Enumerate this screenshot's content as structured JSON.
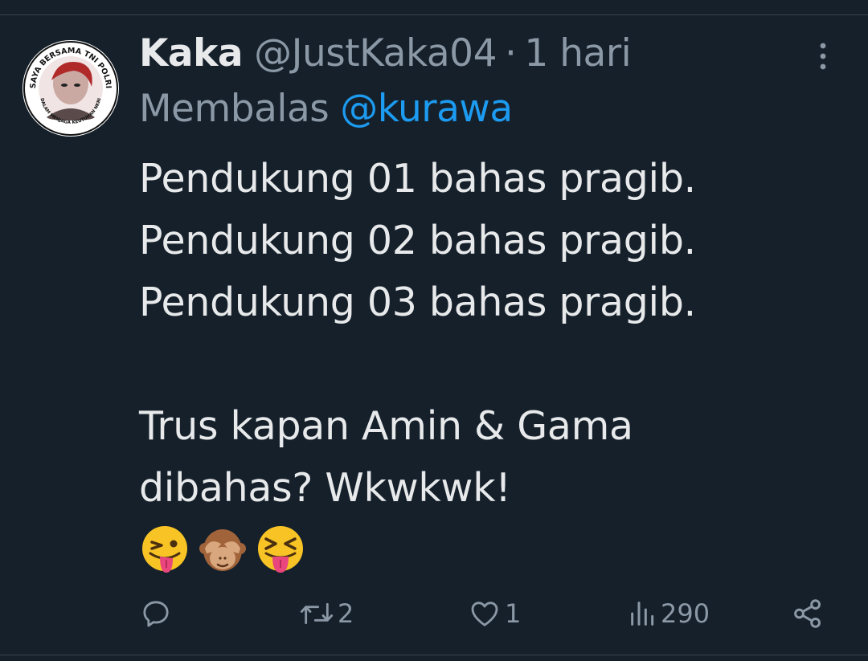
{
  "tweet": {
    "author": {
      "name": "Kaka",
      "handle": "@JustKaka04",
      "avatar_text_top": "SAYA BERSAMA TNI POLRI",
      "avatar_text_bottom": "DALAM MENJAGA KEUTUHAN NKRI"
    },
    "separator": "·",
    "time": "1 hari",
    "reply_prefix": "Membalas",
    "reply_to": "@kurawa",
    "body_lines": [
      "Pendukung 01 bahas pragib.",
      "Pendukung 02 bahas pragib.",
      "Pendukung 03 bahas pragib.",
      "",
      "Trus kapan Amin & Gama",
      "dibahas? Wkwkwk!"
    ],
    "emojis": [
      "winking-face-with-tongue",
      "see-no-evil-monkey",
      "squinting-face-with-tongue"
    ]
  },
  "actions": {
    "reply": {
      "icon": "reply-icon",
      "count": ""
    },
    "retweet": {
      "icon": "retweet-icon",
      "count": "2"
    },
    "like": {
      "icon": "heart-icon",
      "count": "1"
    },
    "views": {
      "icon": "views-icon",
      "count": "290"
    },
    "share": {
      "icon": "share-icon"
    }
  },
  "colors": {
    "background": "#15202b",
    "text": "#e7e9ea",
    "muted": "#8b98a5",
    "link": "#1d9bf0",
    "divider": "#38444d"
  }
}
